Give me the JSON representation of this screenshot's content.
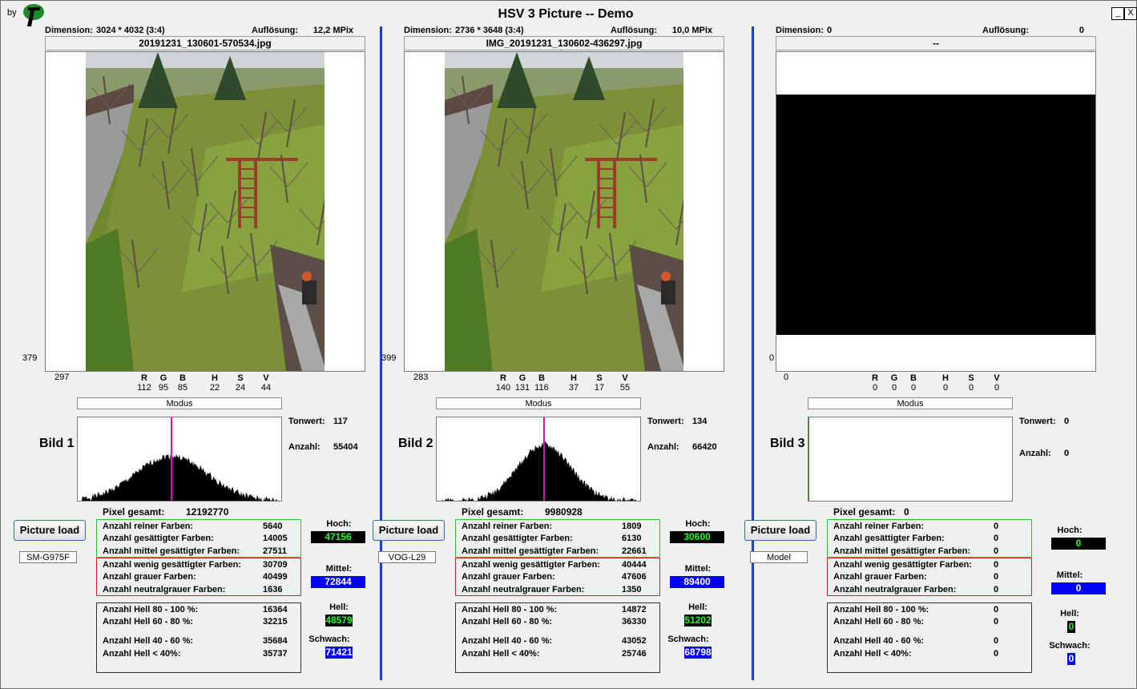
{
  "app": {
    "by": "by",
    "title": "HSV 3 Picture -- Demo",
    "minimize": "_",
    "close": "X"
  },
  "labels": {
    "dimension": "Dimension:",
    "aufloesung": "Auflösung:",
    "modus": "Modus",
    "tonwert": "Tonwert:",
    "anzahl": "Anzahl:",
    "pixel_gesamt": "Pixel gesamt:",
    "picture_load": "Picture load",
    "reine": "Anzahl reiner Farben:",
    "gesaettigt": "Anzahl gesättigter Farben:",
    "mittel_ges": "Anzahl mittel gesättigter Farben:",
    "wenig_ges": "Anzahl wenig gesättigter Farben:",
    "grau": "Anzahl grauer Farben:",
    "neutralgrau": "Anzahl neutralgrauer Farben:",
    "hell80": "Anzahl Hell 80 - 100 %:",
    "hell60": "Anzahl Hell 60 - 80 %:",
    "hell40": "Anzahl Hell 40 - 60 %:",
    "hell_lt40": "Anzahl Hell < 40%:",
    "hoch": "Hoch:",
    "mittel": "Mittel:",
    "hell": "Hell:",
    "schwach": "Schwach:",
    "R": "R",
    "G": "G",
    "B": "B",
    "H": "H",
    "S": "S",
    "V": "V"
  },
  "panels": [
    {
      "dimension": "3024 * 4032 (3:4)",
      "aufloesung": "12,2 MPix",
      "filename": "20191231_130601-570534.jpg",
      "coord_y": "379",
      "coord_x": "297",
      "rgb": {
        "R": "112",
        "G": "95",
        "B": "85",
        "H": "22",
        "S": "24",
        "V": "44"
      },
      "bild": "Bild 1",
      "tonwert": "117",
      "anzahl": "55404",
      "tonwert_marker": 117,
      "pixel_gesamt": "12192770",
      "model": "SM-G975F",
      "reine": "5640",
      "gesaettigt": "14005",
      "mittel_ges": "27511",
      "wenig_ges": "30709",
      "grau": "40499",
      "neutralgrau": "1636",
      "hell80": "16364",
      "hell60": "32215",
      "hell40": "35684",
      "hell_lt40": "35737",
      "hoch": "47156",
      "mittel": "72844",
      "hell": "48579",
      "schwach": "71421"
    },
    {
      "dimension": "2736 * 3648 (3:4)",
      "aufloesung": "10,0 MPix",
      "filename": "IMG_20191231_130602-436297.jpg",
      "coord_y": "399",
      "coord_x": "283",
      "rgb": {
        "R": "140",
        "G": "131",
        "B": "116",
        "H": "37",
        "S": "17",
        "V": "55"
      },
      "bild": "Bild 2",
      "tonwert": "134",
      "anzahl": "66420",
      "tonwert_marker": 134,
      "pixel_gesamt": "9980928",
      "model": "VOG-L29",
      "reine": "1809",
      "gesaettigt": "6130",
      "mittel_ges": "22661",
      "wenig_ges": "40444",
      "grau": "47606",
      "neutralgrau": "1350",
      "hell80": "14872",
      "hell60": "36330",
      "hell40": "43052",
      "hell_lt40": "25746",
      "hoch": "30600",
      "mittel": "89400",
      "hell": "51202",
      "schwach": "68798"
    },
    {
      "dimension": "0",
      "aufloesung": "0",
      "filename": "--",
      "coord_y": "0",
      "coord_x": "0",
      "rgb": {
        "R": "0",
        "G": "0",
        "B": "0",
        "H": "0",
        "S": "0",
        "V": "0"
      },
      "bild": "Bild 3",
      "tonwert": "0",
      "anzahl": "0",
      "tonwert_marker": 0,
      "pixel_gesamt": "0",
      "model": "Model",
      "reine": "0",
      "gesaettigt": "0",
      "mittel_ges": "0",
      "wenig_ges": "0",
      "grau": "0",
      "neutralgrau": "0",
      "hell80": "0",
      "hell60": "0",
      "hell40": "0",
      "hell_lt40": "0",
      "hoch": "0",
      "mittel": "0",
      "hell": "0",
      "schwach": "0"
    }
  ],
  "colors": {
    "hoch_bg": "#000000",
    "hoch_fg": "#22ff22",
    "mittel_bg": "#0000ff",
    "separator": "#1a7a2a",
    "marker": "#e000e0"
  }
}
